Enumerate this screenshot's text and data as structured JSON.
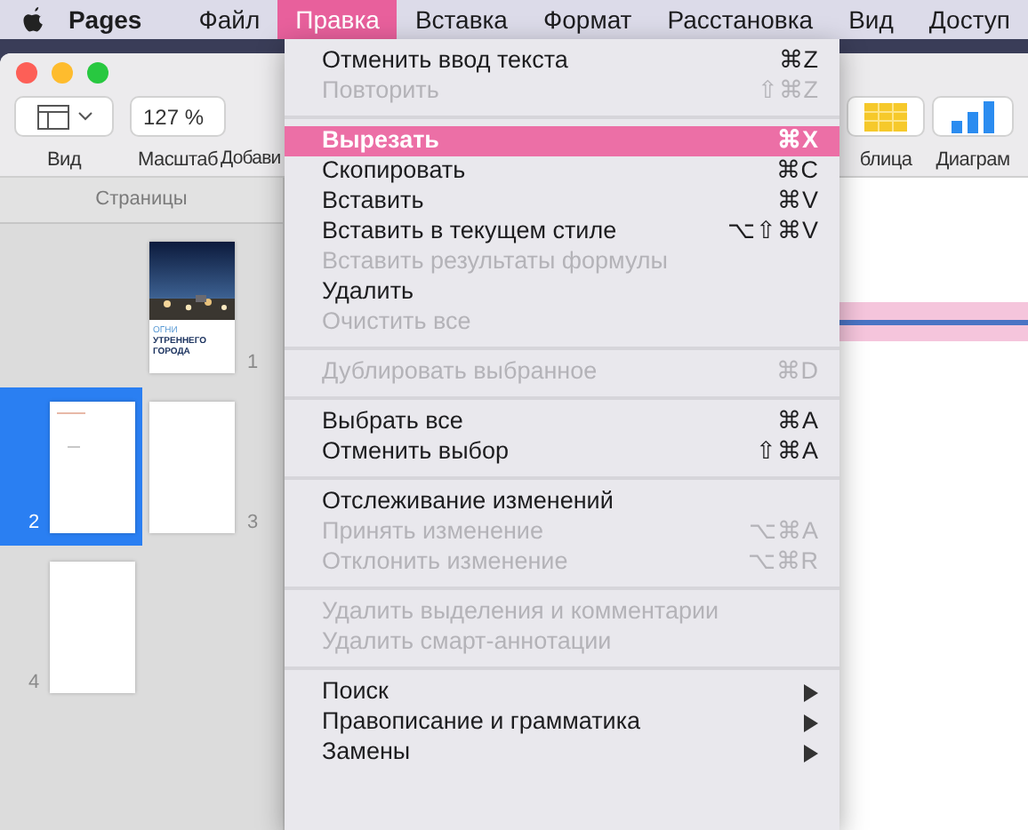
{
  "menubar": {
    "app": "Pages",
    "items": [
      {
        "label": "Файл",
        "selected": false
      },
      {
        "label": "Правка",
        "selected": true
      },
      {
        "label": "Вставка",
        "selected": false
      },
      {
        "label": "Формат",
        "selected": false
      },
      {
        "label": "Расстановка",
        "selected": false
      },
      {
        "label": "Вид",
        "selected": false
      },
      {
        "label": "Доступ",
        "selected": false
      }
    ]
  },
  "toolbar": {
    "left": [
      {
        "kind": "view",
        "label": "Вид"
      },
      {
        "kind": "zoom",
        "value": "127 %",
        "label": "Масштаб"
      },
      {
        "kind": "label_only",
        "label": "Добави"
      }
    ],
    "right": [
      {
        "kind": "table",
        "label": "блица"
      },
      {
        "kind": "chart",
        "label": "Диаграм"
      }
    ]
  },
  "sidebar": {
    "header": "Страницы",
    "pages": [
      {
        "number": "1",
        "selected": false,
        "kind": "cover",
        "cover_title": "ОГНИ",
        "cover_subtitle": "УТРЕННЕГО ГОРОДА"
      },
      {
        "number": "2",
        "selected": true,
        "kind": "text"
      },
      {
        "number": "3",
        "selected": false,
        "kind": "blank"
      },
      {
        "number": "4",
        "selected": false,
        "kind": "blank"
      }
    ]
  },
  "edit_menu": [
    {
      "kind": "item",
      "label": "Отменить ввод текста",
      "shortcut": "⌘Z",
      "disabled": false,
      "selected": false
    },
    {
      "kind": "item",
      "label": "Повторить",
      "shortcut": "⇧⌘Z",
      "disabled": true,
      "selected": false
    },
    {
      "kind": "separator"
    },
    {
      "kind": "item",
      "label": "Вырезать",
      "shortcut": "⌘X",
      "disabled": false,
      "selected": true
    },
    {
      "kind": "item",
      "label": "Скопировать",
      "shortcut": "⌘C",
      "disabled": false,
      "selected": false
    },
    {
      "kind": "item",
      "label": "Вставить",
      "shortcut": "⌘V",
      "disabled": false,
      "selected": false
    },
    {
      "kind": "item",
      "label": "Вставить в текущем стиле",
      "shortcut": "⌥⇧⌘V",
      "disabled": false,
      "selected": false
    },
    {
      "kind": "item",
      "label": "Вставить результаты формулы",
      "disabled": true,
      "selected": false
    },
    {
      "kind": "item",
      "label": "Удалить",
      "disabled": false,
      "selected": false
    },
    {
      "kind": "item",
      "label": "Очистить все",
      "disabled": true,
      "selected": false
    },
    {
      "kind": "separator"
    },
    {
      "kind": "item",
      "label": "Дублировать выбранное",
      "shortcut": "⌘D",
      "disabled": true,
      "selected": false
    },
    {
      "kind": "separator"
    },
    {
      "kind": "item",
      "label": "Выбрать все",
      "shortcut": "⌘A",
      "disabled": false,
      "selected": false
    },
    {
      "kind": "item",
      "label": "Отменить выбор",
      "shortcut": "⇧⌘A",
      "disabled": false,
      "selected": false
    },
    {
      "kind": "separator"
    },
    {
      "kind": "item",
      "label": "Отслеживание изменений",
      "disabled": false,
      "selected": false
    },
    {
      "kind": "item",
      "label": "Принять изменение",
      "shortcut": "⌥⌘A",
      "disabled": true,
      "selected": false
    },
    {
      "kind": "item",
      "label": "Отклонить изменение",
      "shortcut": "⌥⌘R",
      "disabled": true,
      "selected": false
    },
    {
      "kind": "separator"
    },
    {
      "kind": "item",
      "label": "Удалить выделения и комментарии",
      "disabled": true,
      "selected": false
    },
    {
      "kind": "item",
      "label": "Удалить смарт-аннотации",
      "disabled": true,
      "selected": false
    },
    {
      "kind": "separator"
    },
    {
      "kind": "submenu",
      "label": "Поиск",
      "disabled": false,
      "selected": false
    },
    {
      "kind": "submenu",
      "label": "Правописание и грамматика",
      "disabled": false,
      "selected": false
    },
    {
      "kind": "submenu",
      "label": "Замены",
      "disabled": false,
      "selected": false
    }
  ]
}
